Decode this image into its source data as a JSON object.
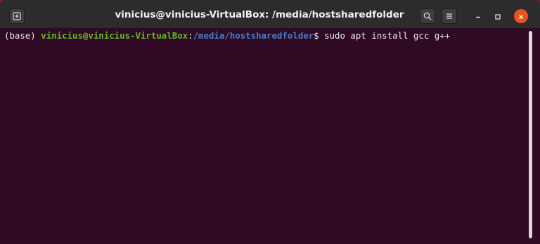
{
  "window": {
    "title": "vinicius@vinicius-VirtualBox: /media/hostsharedfolder"
  },
  "terminal": {
    "env": "(base)",
    "user_host": "vinicius@vinicius-VirtualBox",
    "separator": ":",
    "path": "/media/hostsharedfolder",
    "prompt_symbol": "$",
    "command": "sudo apt install gcc g++"
  },
  "icons": {
    "new_tab": "new-tab-icon",
    "search": "search-icon",
    "menu": "hamburger-menu-icon",
    "minimize": "minimize-icon",
    "maximize": "maximize-icon",
    "close": "close-icon"
  },
  "colors": {
    "terminal_bg": "#300a24",
    "prompt_user": "#5ebc1c",
    "prompt_path": "#4b7cc8",
    "close_button": "#e95420",
    "titlebar_bg": "#2c2c2c"
  }
}
